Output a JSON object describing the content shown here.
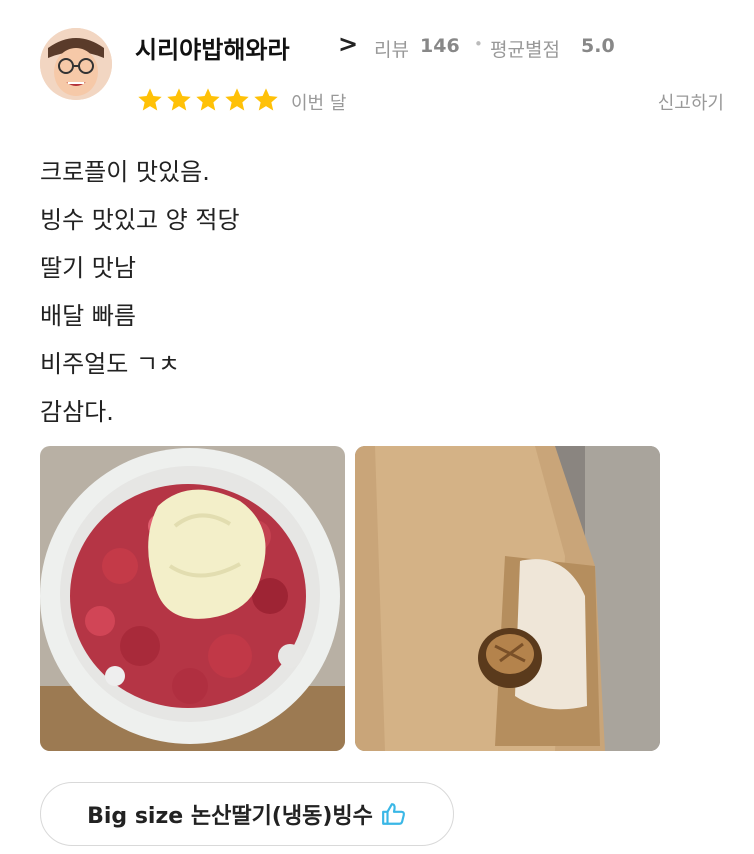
{
  "review": {
    "reviewer_name": "시리야밥해와라",
    "chevron": ">",
    "review_count_label": "리뷰",
    "review_count": "146",
    "avg_rating_label": "평균별점",
    "avg_rating": "5.0",
    "separator": "•",
    "rating": 5,
    "date": "이번 달",
    "report_label": "신고하기",
    "text_lines": [
      "크로플이 맛있음.",
      "빙수 맛있고 양 적당",
      "딸기 맛남",
      "배달 빠름",
      "비주얼도 ㄱㅊ",
      "감삼다."
    ],
    "menu_tag": "Big size 논산딸기(냉동)빙수"
  },
  "colors": {
    "star": "#FFC107",
    "thumb_icon": "#3AB7E6",
    "muted_text": "#999999"
  },
  "icons": {
    "rating": "star-icon",
    "menu_recommend": "thumbs-up-icon"
  }
}
